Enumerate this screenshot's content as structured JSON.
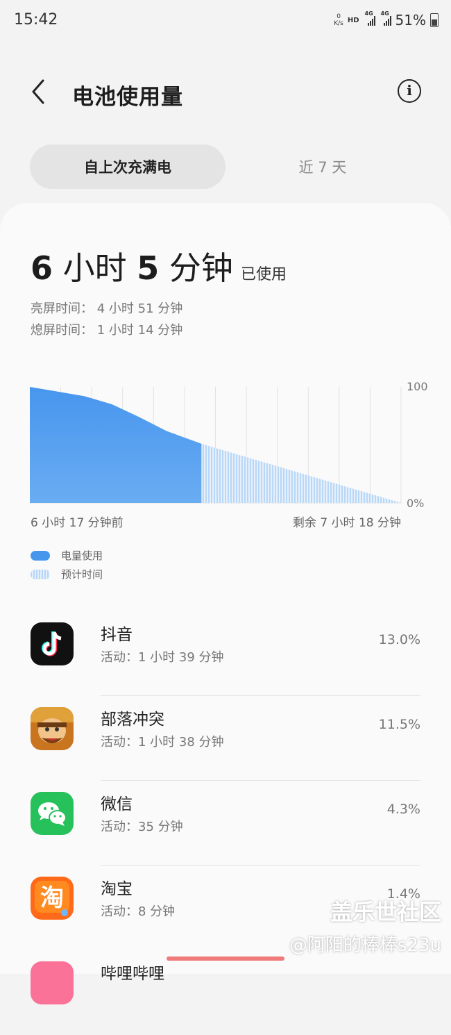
{
  "status_bar": {
    "time": "15:42",
    "net_speed_value": "0",
    "net_speed_unit": "K/s",
    "hd": "HD",
    "net1": "4G",
    "net2": "4G",
    "battery": "51%"
  },
  "header": {
    "title": "电池使用量"
  },
  "tabs": {
    "active": "自上次充满电",
    "inactive": "近 7 天"
  },
  "summary": {
    "hours": "6",
    "hours_unit": "小时",
    "minutes": "5",
    "minutes_unit": "分钟",
    "used_label": "已使用",
    "screen_on": "亮屏时间：  4 小时 51 分钟",
    "screen_off": "熄屏时间：  1 小时 14 分钟"
  },
  "chart_data": {
    "type": "area",
    "y_tick_top": "100",
    "y_tick_bottom": "0%",
    "ylim": [
      0,
      100
    ],
    "x_start_label": "6 小时 17 分钟前",
    "x_end_label": "剩余 7 小时 18 分钟",
    "series": [
      {
        "name": "电量使用",
        "x": [
          0,
          1,
          2,
          3,
          4,
          5,
          6.28
        ],
        "y": [
          100,
          96,
          92,
          85,
          74,
          62,
          51
        ]
      },
      {
        "name": "预计时间",
        "x": [
          6.28,
          13.58
        ],
        "y": [
          51,
          0
        ]
      }
    ],
    "grid": true
  },
  "legend": {
    "used": "电量使用",
    "estimate": "预计时间"
  },
  "apps": [
    {
      "name": "抖音",
      "activity": "活动：1 小时 39 分钟",
      "percent": "13.0%",
      "icon": "tiktok-icon"
    },
    {
      "name": "部落冲突",
      "activity": "活动：1 小时 38 分钟",
      "percent": "11.5%",
      "icon": "clash-of-clans-icon"
    },
    {
      "name": "微信",
      "activity": "活动：35 分钟",
      "percent": "4.3%",
      "icon": "wechat-icon"
    },
    {
      "name": "淘宝",
      "activity": "活动：8 分钟",
      "percent": "1.4%",
      "icon": "taobao-icon"
    },
    {
      "name": "哔哩哔哩",
      "activity": "",
      "percent": "",
      "icon": "bilibili-icon"
    }
  ],
  "watermark": {
    "line1": "盖乐世社区",
    "line2": "@阿阳的棒棒s23u"
  },
  "colors": {
    "used": "#4796ee",
    "estimate": "#b7d6f7",
    "background": "#f3f3f3"
  }
}
